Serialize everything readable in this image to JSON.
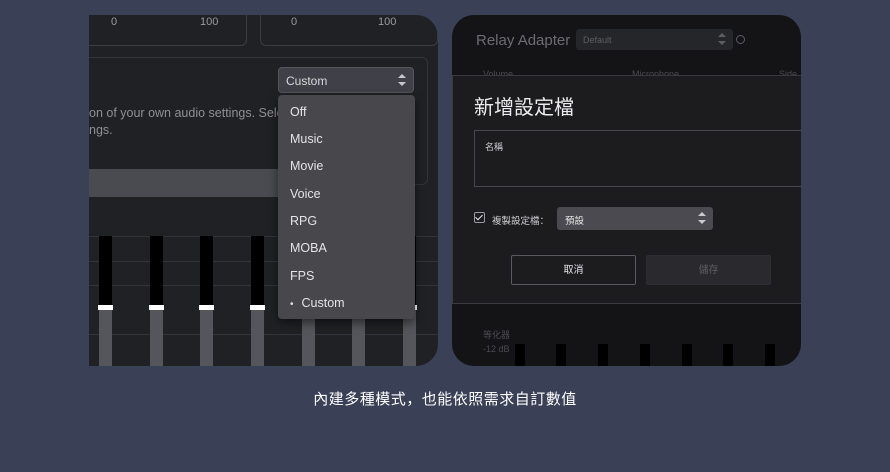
{
  "left_panel": {
    "meter_labels": [
      "0",
      "100",
      "0",
      "100"
    ],
    "description_lines": [
      "on of your own audio settings. Sele",
      "ngs."
    ],
    "preset_select": {
      "value": "Custom",
      "icon": "updown-arrows-icon"
    },
    "preset_menu": {
      "items": [
        "Off",
        "Music",
        "Movie",
        "Voice",
        "RPG",
        "MOBA",
        "FPS",
        "Custom"
      ],
      "selected": "Custom",
      "selected_marker": "•"
    },
    "eq_level_fraction": 0.5
  },
  "right_panel": {
    "app_title": "Relay Adapter",
    "profile_select": {
      "value": "Default"
    },
    "background_labels": {
      "volume": "Volume",
      "microphone": "Microphone",
      "side": "Side",
      "equalizer": "等化器",
      "db": "-12 dB"
    },
    "dialog": {
      "title": "新增設定檔",
      "name_label": "名稱",
      "copy_checkbox_label": "複製設定檔：",
      "copy_checked": true,
      "copy_select_value": "預設",
      "cancel_label": "取消",
      "save_label": "儲存"
    }
  },
  "caption": "內建多種模式，也能依照需求自訂數值",
  "colors": {
    "background": "#3a4056",
    "panel": "#202124",
    "menu": "#47474c"
  }
}
